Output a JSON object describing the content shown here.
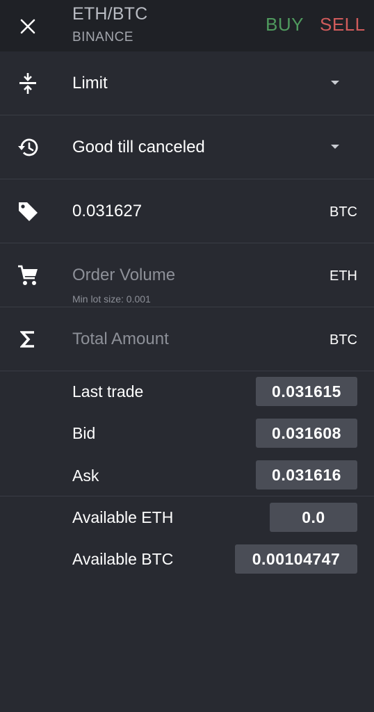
{
  "header": {
    "title": "ETH/BTC",
    "subtitle": "BINANCE",
    "buy_label": "BUY",
    "sell_label": "SELL",
    "close_icon": "close-icon"
  },
  "form": {
    "order_type": {
      "icon": "compress-icon",
      "value": "Limit"
    },
    "time_in_force": {
      "icon": "history-icon",
      "value": "Good till canceled"
    },
    "price": {
      "icon": "tag-icon",
      "value": "0.031627",
      "unit": "BTC"
    },
    "volume": {
      "icon": "cart-icon",
      "placeholder": "Order Volume",
      "hint": "Min lot size: 0.001",
      "unit": "ETH"
    },
    "total": {
      "icon": "sigma-icon",
      "placeholder": "Total Amount",
      "unit": "BTC"
    }
  },
  "market": {
    "last_trade": {
      "label": "Last trade",
      "value": "0.031615"
    },
    "bid": {
      "label": "Bid",
      "value": "0.031608"
    },
    "ask": {
      "label": "Ask",
      "value": "0.031616"
    }
  },
  "balances": {
    "eth": {
      "label": "Available ETH",
      "value": "0.0"
    },
    "btc": {
      "label": "Available BTC",
      "value": "0.00104747"
    }
  },
  "colors": {
    "background": "#282a31",
    "header": "#1f2126",
    "buy": "#4f9a5e",
    "sell": "#d05b5b",
    "value_box": "#4a4d56"
  }
}
